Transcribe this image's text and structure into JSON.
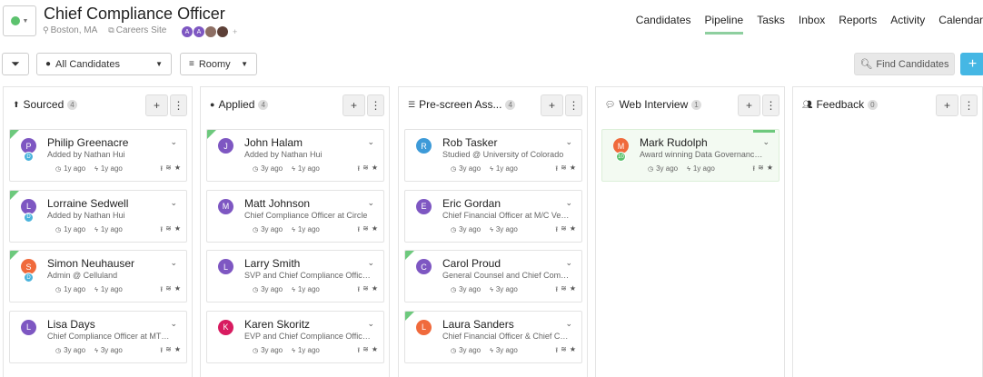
{
  "header": {
    "title": "Chief Compliance Officer",
    "location": "Boston, MA",
    "careers_link": "Careers Site",
    "team_avatars": [
      {
        "initial": "A",
        "color": "#7e57c2"
      },
      {
        "initial": "A",
        "color": "#7e57c2"
      },
      {
        "initial": "",
        "color": "#8d6e63"
      },
      {
        "initial": "",
        "color": "#5d4037"
      }
    ],
    "add_member": "+"
  },
  "nav": [
    "Candidates",
    "Pipeline",
    "Tasks",
    "Inbox",
    "Reports",
    "Activity",
    "Calendar"
  ],
  "nav_active": "Pipeline",
  "toolbar": {
    "candidates_filter": "All Candidates",
    "view_mode": "Roomy",
    "find_label": "Find Candidates",
    "add_label": "+"
  },
  "columns": [
    {
      "title": "Sourced",
      "icon": "upload-icon",
      "count": "4",
      "cards": [
        {
          "name": "Philip Greenacre",
          "sub": "Added by Nathan Hui",
          "initial": "P",
          "color": "#7e57c2",
          "badge": "D",
          "badge_color": "#4ab3dc",
          "t1": "1y ago",
          "t2": "1y ago",
          "flag": true
        },
        {
          "name": "Lorraine Sedwell",
          "sub": "Added by Nathan Hui",
          "initial": "L",
          "color": "#7e57c2",
          "badge": "D",
          "badge_color": "#4ab3dc",
          "t1": "1y ago",
          "t2": "1y ago",
          "flag": true
        },
        {
          "name": "Simon Neuhauser",
          "sub": "Admin @ Celluland",
          "initial": "S",
          "color": "#f06a3c",
          "badge": "D",
          "badge_color": "#4ab3dc",
          "t1": "1y ago",
          "t2": "1y ago",
          "flag": true
        },
        {
          "name": "Lisa Days",
          "sub": "Chief Compliance Officer at MTS ...",
          "initial": "L",
          "color": "#7e57c2",
          "badge": "",
          "badge_color": "",
          "t1": "3y ago",
          "t2": "3y ago",
          "flag": false
        }
      ]
    },
    {
      "title": "Applied",
      "icon": "user-icon",
      "count": "4",
      "cards": [
        {
          "name": "John Halam",
          "sub": "Added by Nathan Hui",
          "initial": "J",
          "color": "#7e57c2",
          "badge": "",
          "badge_color": "",
          "t1": "3y ago",
          "t2": "1y ago",
          "flag": true
        },
        {
          "name": "Matt Johnson",
          "sub": "Chief Compliance Officer at Circle",
          "initial": "M",
          "color": "#7e57c2",
          "badge": "",
          "badge_color": "",
          "t1": "3y ago",
          "t2": "1y ago",
          "flag": false
        },
        {
          "name": "Larry Smith",
          "sub": "SVP and Chief Compliance Officer...",
          "initial": "L",
          "color": "#7e57c2",
          "badge": "",
          "badge_color": "",
          "t1": "3y ago",
          "t2": "1y ago",
          "flag": false
        },
        {
          "name": "Karen Skoritz",
          "sub": "EVP and Chief Compliance Officer...",
          "initial": "K",
          "color": "#d81b60",
          "badge": "",
          "badge_color": "",
          "t1": "3y ago",
          "t2": "1y ago",
          "flag": false
        }
      ]
    },
    {
      "title": "Pre-screen Ass...",
      "icon": "list-icon",
      "count": "4",
      "cards": [
        {
          "name": "Rob Tasker",
          "sub": "Studied @ University of Colorado",
          "initial": "R",
          "color": "#3d9ad8",
          "badge": "",
          "badge_color": "",
          "t1": "3y ago",
          "t2": "1y ago",
          "flag": false
        },
        {
          "name": "Eric Gordan",
          "sub": "Chief Financial Officer at M/C Vent...",
          "initial": "E",
          "color": "#7e57c2",
          "badge": "",
          "badge_color": "",
          "t1": "3y ago",
          "t2": "3y ago",
          "flag": false
        },
        {
          "name": "Carol Proud",
          "sub": "General Counsel and Chief Compl...",
          "initial": "C",
          "color": "#7e57c2",
          "badge": "",
          "badge_color": "",
          "t1": "3y ago",
          "t2": "3y ago",
          "flag": true
        },
        {
          "name": "Laura Sanders",
          "sub": "Chief Financial Officer & Chief Co...",
          "initial": "L",
          "color": "#f06a3c",
          "badge": "",
          "badge_color": "",
          "t1": "3y ago",
          "t2": "3y ago",
          "flag": true
        }
      ]
    },
    {
      "title": "Web Interview",
      "icon": "comments-icon",
      "count": "1",
      "cards": [
        {
          "name": "Mark Rudolph",
          "sub": "Award winning Data Governance ...",
          "initial": "M",
          "color": "#f06a3c",
          "badge": "10",
          "badge_color": "#5cc26e",
          "t1": "3y ago",
          "t2": "1y ago",
          "flag": false,
          "highlight": true
        }
      ]
    },
    {
      "title": "Feedback",
      "icon": "users-icon",
      "count": "0",
      "cards": []
    }
  ],
  "column_buttons": {
    "add": "+",
    "menu": "⋮"
  }
}
